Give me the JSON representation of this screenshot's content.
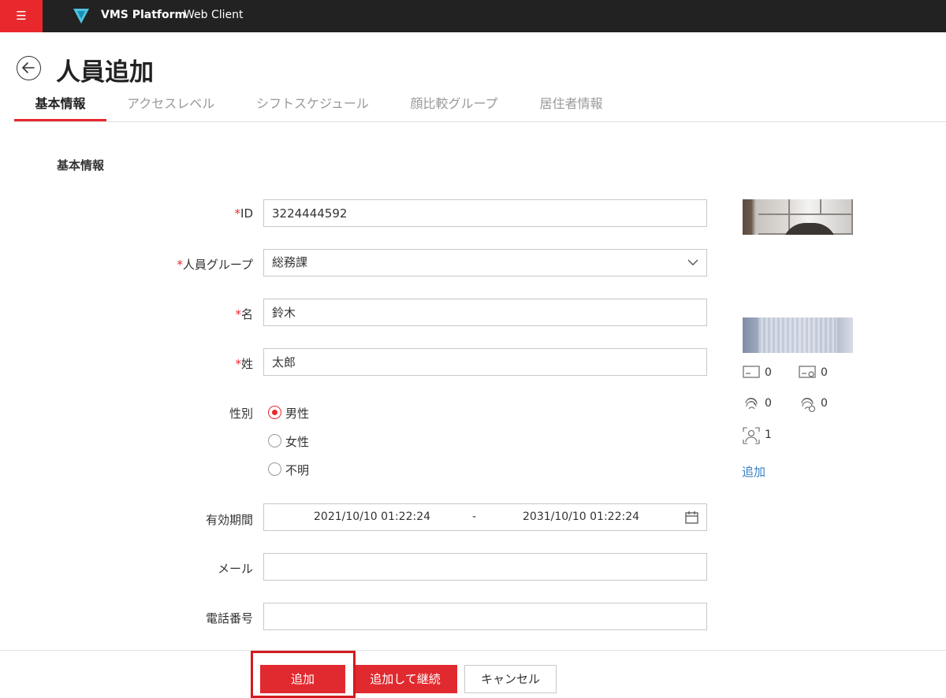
{
  "topbar": {
    "menu_icon": "☰",
    "app_name": "VMS Platform",
    "app_subtitle": "Web Client"
  },
  "header": {
    "title": "人員追加"
  },
  "tabs": [
    {
      "label": "基本情報",
      "active": true
    },
    {
      "label": "アクセスレベル",
      "active": false
    },
    {
      "label": "シフトスケジュール",
      "active": false
    },
    {
      "label": "顔比較グループ",
      "active": false
    },
    {
      "label": "居住者情報",
      "active": false
    }
  ],
  "section": {
    "title": "基本情報"
  },
  "form": {
    "required_mark": "*",
    "id": {
      "label": "ID",
      "value": "3224444592"
    },
    "group": {
      "label": "人員グループ",
      "value": "総務課"
    },
    "first_name": {
      "label": "名",
      "value": "鈴木"
    },
    "last_name": {
      "label": "姓",
      "value": "太郎"
    },
    "gender": {
      "label": "性別",
      "options": [
        "男性",
        "女性",
        "不明"
      ],
      "selected": "男性"
    },
    "validity": {
      "label": "有効期間",
      "start": "2021/10/10 01:22:24",
      "separator": "-",
      "end": "2031/10/10 01:22:24"
    },
    "email": {
      "label": "メール",
      "value": ""
    },
    "phone": {
      "label": "電話番号",
      "value": ""
    }
  },
  "side_panel": {
    "stats": {
      "card": "0",
      "card_alt": "0",
      "fingerprint": "0",
      "fingerprint_alt": "0",
      "face": "1"
    },
    "add_link": "追加"
  },
  "footer": {
    "add_label": "追加",
    "add_continue_label": "追加して継続",
    "cancel_label": "キャンセル"
  },
  "colors": {
    "accent": "#e8282d",
    "link": "#3a7fc4",
    "topbar": "#222222"
  }
}
